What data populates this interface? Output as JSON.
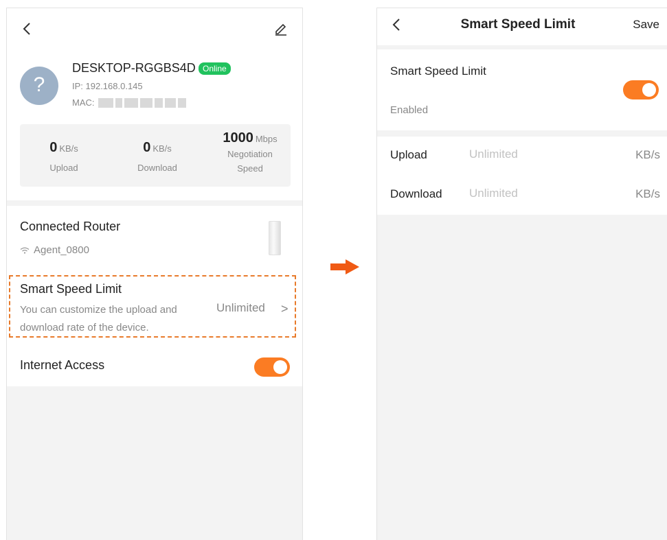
{
  "left": {
    "device": {
      "name": "DESKTOP-RGGBS4D",
      "status": "Online",
      "ip": "IP: 192.168.0.145",
      "mac_label": "MAC:",
      "avatar_glyph": "?"
    },
    "stats": {
      "upload": {
        "value": "0",
        "unit": "KB/s",
        "label": "Upload"
      },
      "download": {
        "value": "0",
        "unit": "KB/s",
        "label": "Download"
      },
      "negotiation": {
        "value": "1000",
        "unit": "Mbps",
        "label_line1": "Negotiation",
        "label_line2": "Speed"
      }
    },
    "router": {
      "title": "Connected Router",
      "ssid": "Agent_0800"
    },
    "smart_speed_limit": {
      "title": "Smart Speed Limit",
      "description": "You can customize the upload and download rate of the device.",
      "value": "Unlimited",
      "chevron": ">"
    },
    "internet_access": {
      "label": "Internet Access",
      "enabled": true
    }
  },
  "right": {
    "header": {
      "title": "Smart Speed Limit",
      "save_label": "Save"
    },
    "smart_speed_limit": {
      "title": "Smart Speed Limit",
      "status": "Enabled",
      "enabled": true
    },
    "upload": {
      "label": "Upload",
      "placeholder": "Unlimited",
      "unit": "KB/s"
    },
    "download": {
      "label": "Download",
      "placeholder": "Unlimited",
      "unit": "KB/s"
    }
  },
  "colors": {
    "accent": "#fb7c23",
    "online_badge": "#21c25e",
    "dashed_highlight": "#e87a2a",
    "arrow": "#f05a14"
  },
  "icons": [
    "back-arrow-icon",
    "edit-pencil-icon",
    "wifi-icon",
    "router-device-icon",
    "chevron-right-icon",
    "right-arrow-icon"
  ]
}
